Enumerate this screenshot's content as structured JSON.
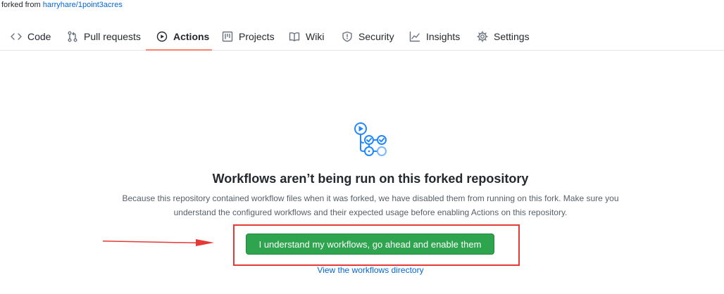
{
  "fork": {
    "prefix": "forked from",
    "repo": "harryhare/1point3acres"
  },
  "tabs": [
    {
      "label": "Code",
      "icon": "code-icon"
    },
    {
      "label": "Pull requests",
      "icon": "pull-request-icon"
    },
    {
      "label": "Actions",
      "icon": "play-icon",
      "active": true
    },
    {
      "label": "Projects",
      "icon": "project-icon"
    },
    {
      "label": "Wiki",
      "icon": "book-icon"
    },
    {
      "label": "Security",
      "icon": "shield-icon"
    },
    {
      "label": "Insights",
      "icon": "graph-icon"
    },
    {
      "label": "Settings",
      "icon": "gear-icon"
    }
  ],
  "main": {
    "title": "Workflows aren’t being run on this forked repository",
    "description": "Because this repository contained workflow files when it was forked, we have disabled them from running on this fork. Make sure you understand the configured workflows and their expected usage before enabling Actions on this repository.",
    "enable_button": "I understand my workflows, go ahead and enable them",
    "view_link": "View the workflows directory"
  },
  "colors": {
    "accent_blue": "#0366d6",
    "button_green": "#2ea44f",
    "annotation_red": "#e53935",
    "tab_underline": "#f9826c",
    "workflow_icon_blue": "#2188ff"
  }
}
